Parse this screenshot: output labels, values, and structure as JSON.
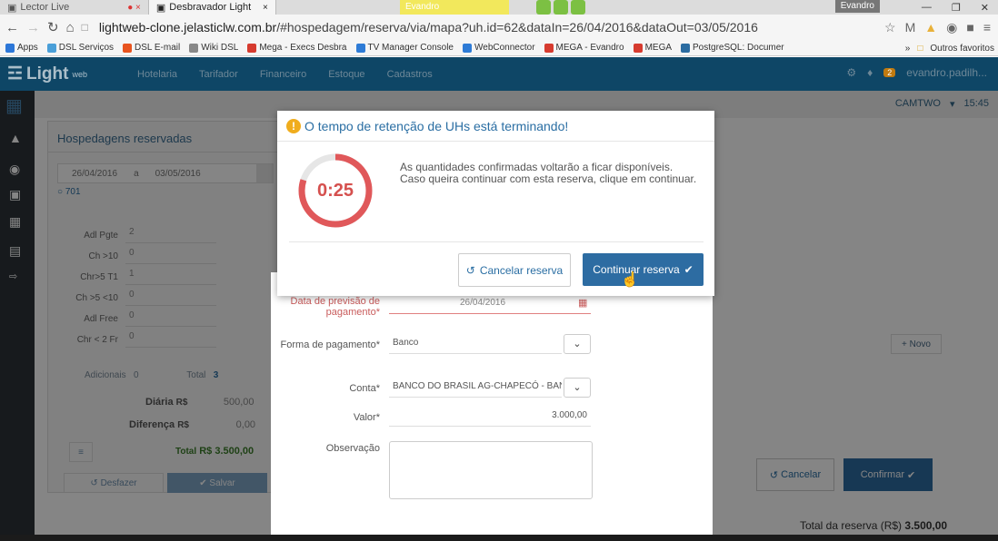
{
  "browser": {
    "tabs": [
      {
        "label": "Lector Live"
      },
      {
        "label": "Desbravador Light"
      }
    ],
    "profile_tab": "Evandro",
    "window_user": "Evandro",
    "url_host": "lightweb-clone.jelasticlw.com.br",
    "url_path": "/#hospedagem/reserva/via/mapa?uh.id=62&dataIn=26/04/2016&dataOut=03/05/2016",
    "bookmarks": [
      {
        "label": "Apps",
        "color": "#2d77d8"
      },
      {
        "label": "DSL Serviços",
        "color": "#4a9fd8"
      },
      {
        "label": "DSL E-mail",
        "color": "#e8541f"
      },
      {
        "label": "Wiki DSL",
        "color": "#888888"
      },
      {
        "label": "Mega - Execs Desbra",
        "color": "#d63b2f"
      },
      {
        "label": "TV Manager Console",
        "color": "#2e7bd6"
      },
      {
        "label": "WebConnector",
        "color": "#2e7bd6"
      },
      {
        "label": "MEGA - Evandro",
        "color": "#d63b2f"
      },
      {
        "label": "MEGA",
        "color": "#d63b2f"
      },
      {
        "label": "PostgreSQL: Documer",
        "color": "#2b6ca1"
      }
    ],
    "bookmarks_more": "»",
    "bookmarks_other": "Outros favoritos"
  },
  "app": {
    "logo": "Light",
    "logo_small": "web",
    "menu": [
      "Hotelaria",
      "Tarifador",
      "Financeiro",
      "Estoque",
      "Cadastros"
    ],
    "notif_count": "2",
    "user": "evandro.padilh...",
    "hotel": "CAMTWO",
    "time": "15:45",
    "panel_title": "Hospedagens reservadas",
    "date_from": "26/04/2016",
    "date_sep": "a",
    "date_to": "03/05/2016",
    "uh": "701",
    "guests": [
      {
        "label": "Adl Pgte",
        "value": "2"
      },
      {
        "label": "Ch >10",
        "value": "0"
      },
      {
        "label": "Chr>5 T1",
        "value": "1"
      },
      {
        "label": "Ch >5 <10",
        "value": "0"
      },
      {
        "label": "Adl Free",
        "value": "0"
      },
      {
        "label": "Chr < 2 Fr",
        "value": "0"
      }
    ],
    "adicionais_label": "Adicionais",
    "adicionais_value": "0",
    "total_label": "Total",
    "total_value": "3",
    "diaria_label": "Diária",
    "diaria_currency": "R$",
    "diaria_value": "500,00",
    "diferenca_label": "Diferença",
    "diferenca_currency": "R$",
    "diferenca_value": "0,00",
    "total_reserva_label": "Total",
    "total_reserva_value": "R$ 3.500,00",
    "desfazer": "Desfazer",
    "salvar": "Salvar",
    "novo": "+ Novo",
    "cancelar": "Cancelar",
    "confirmar": "Confirmar",
    "footer_total_label": "Total da reserva (R$)",
    "footer_total_value": "3.500,00"
  },
  "payment_form": {
    "previsao_label": "Data de previsão de pagamento*",
    "previsao_value": "26/04/2016",
    "forma_label": "Forma de pagamento*",
    "forma_value": "Banco",
    "conta_label": "Conta*",
    "conta_value": "BANCO DO BRASIL AG-CHAPECÓ - BAN",
    "valor_label": "Valor*",
    "valor_value": "3.000,00",
    "obs_label": "Observação"
  },
  "dialog": {
    "title": "O tempo de retenção de UHs está terminando!",
    "timer": "0:25",
    "timer_fraction": 0.8,
    "message": "As quantidades confirmadas voltarão a ficar disponíveis. Caso queira continuar com esta reserva, clique em continuar.",
    "cancel_label": "Cancelar reserva",
    "continue_label": "Continuar reserva"
  },
  "colors": {
    "accent": "#2d6ca2",
    "warning": "#f0ad1d",
    "timer": "#e0585a"
  }
}
